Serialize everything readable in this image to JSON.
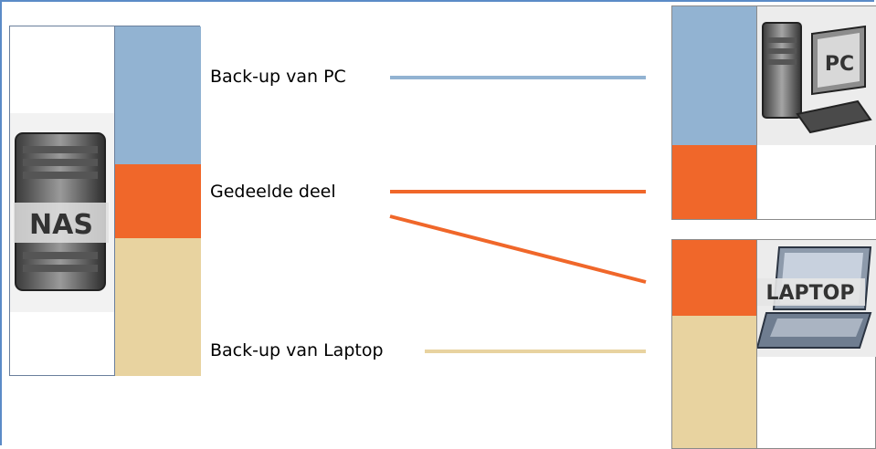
{
  "diagram": {
    "nas": {
      "label": "NAS",
      "icon": "nas-server-icon"
    },
    "pc": {
      "label": "PC",
      "icon": "desktop-pc-icon"
    },
    "laptop": {
      "label": "LAPTOP",
      "icon": "laptop-icon"
    },
    "connections": [
      {
        "label": "Back-up van PC",
        "color": "#92b3d2"
      },
      {
        "label": "Gedeelde deel",
        "color": "#f0672a"
      },
      {
        "label": "Back-up van Laptop",
        "color": "#e8d3a0"
      }
    ],
    "colors": {
      "pc_backup": "#92b3d2",
      "shared": "#f0672a",
      "laptop_backup": "#e8d3a0",
      "frame": "#5b8bc7"
    }
  }
}
